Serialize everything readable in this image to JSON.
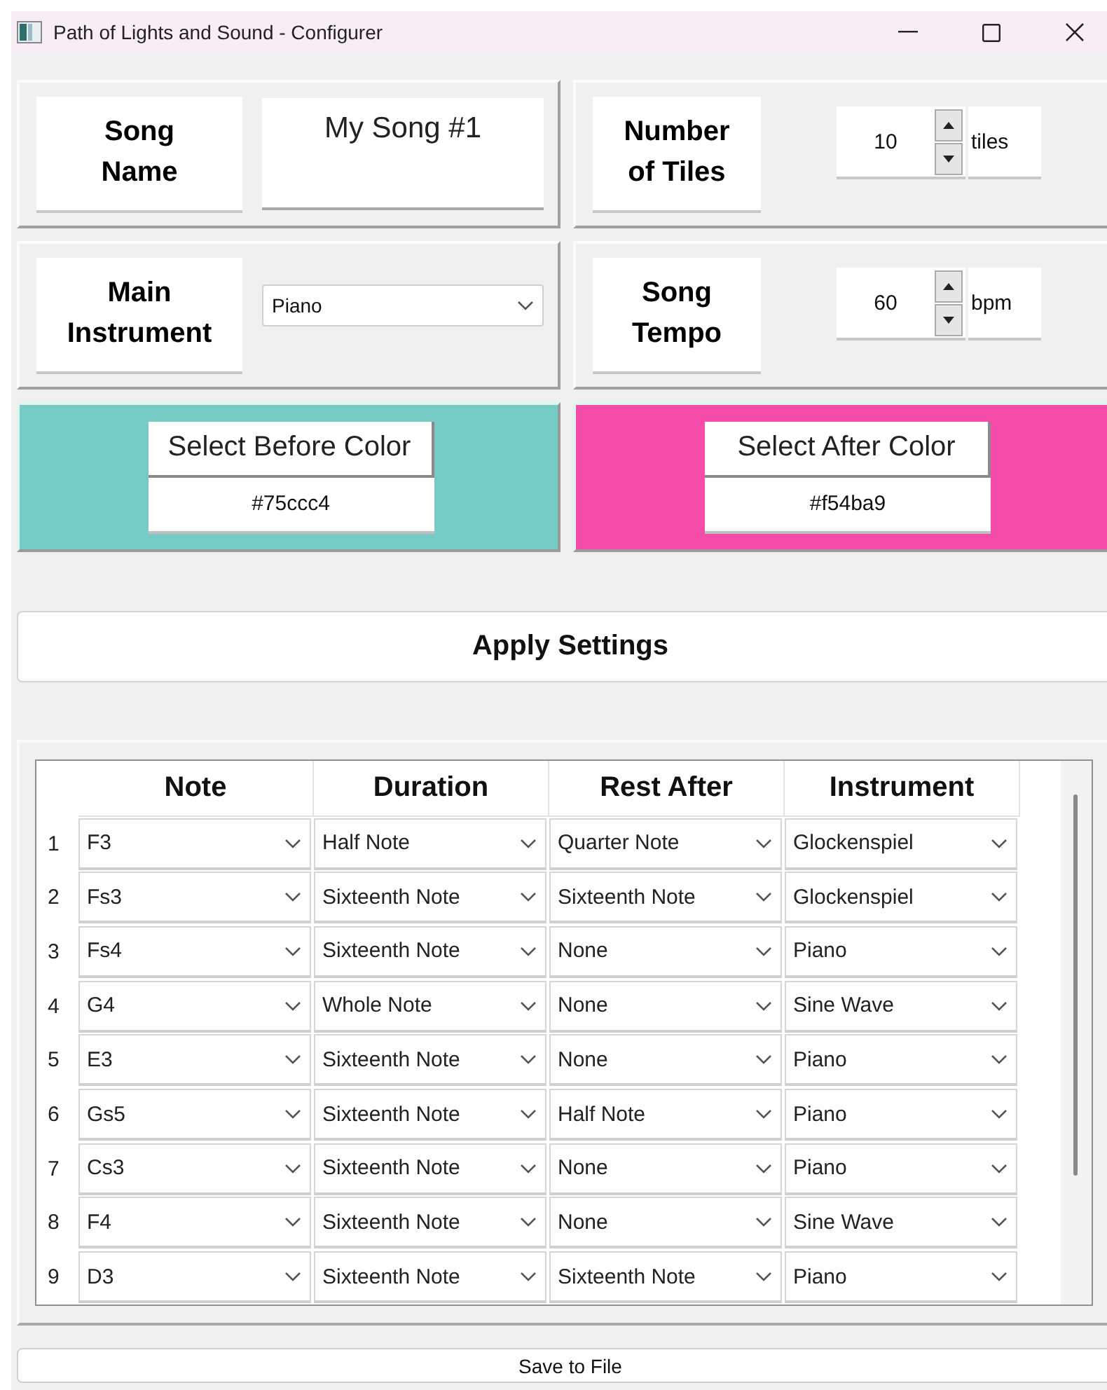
{
  "window": {
    "title": "Path of Lights and Sound - Configurer"
  },
  "settings": [
    {
      "kind": "text",
      "label": "Song\nName",
      "value": "My Song #1"
    },
    {
      "kind": "spin",
      "label": "Number\nof Tiles",
      "value": "10",
      "unit": "tiles"
    },
    {
      "kind": "dropdown",
      "label": "Main\nInstrument",
      "value": "Piano"
    },
    {
      "kind": "spin",
      "label": "Song\nTempo",
      "value": "60",
      "unit": "bpm"
    }
  ],
  "colors": [
    {
      "button": "Select Before Color",
      "hex": "#75ccc4",
      "color": "#75ccc4"
    },
    {
      "button": "Select After Color",
      "hex": "#f54ba9",
      "color": "#f54ba9"
    }
  ],
  "apply_button": "Apply Settings",
  "table": {
    "columns": [
      "Note",
      "Duration",
      "Rest After",
      "Instrument"
    ],
    "rows": [
      {
        "number": "1",
        "cells": [
          "F3",
          "Half Note",
          "Quarter Note",
          "Glockenspiel"
        ]
      },
      {
        "number": "2",
        "cells": [
          "Fs3",
          "Sixteenth Note",
          "Sixteenth Note",
          "Glockenspiel"
        ]
      },
      {
        "number": "3",
        "cells": [
          "Fs4",
          "Sixteenth Note",
          "None",
          "Piano"
        ]
      },
      {
        "number": "4",
        "cells": [
          "G4",
          "Whole Note",
          "None",
          "Sine Wave"
        ]
      },
      {
        "number": "5",
        "cells": [
          "E3",
          "Sixteenth Note",
          "None",
          "Piano"
        ]
      },
      {
        "number": "6",
        "cells": [
          "Gs5",
          "Sixteenth Note",
          "Half Note",
          "Piano"
        ]
      },
      {
        "number": "7",
        "cells": [
          "Cs3",
          "Sixteenth Note",
          "None",
          "Piano"
        ]
      },
      {
        "number": "8",
        "cells": [
          "F4",
          "Sixteenth Note",
          "None",
          "Sine Wave"
        ]
      },
      {
        "number": "9",
        "cells": [
          "D3",
          "Sixteenth Note",
          "Sixteenth Note",
          "Piano"
        ]
      }
    ]
  },
  "save_button": "Save to File"
}
